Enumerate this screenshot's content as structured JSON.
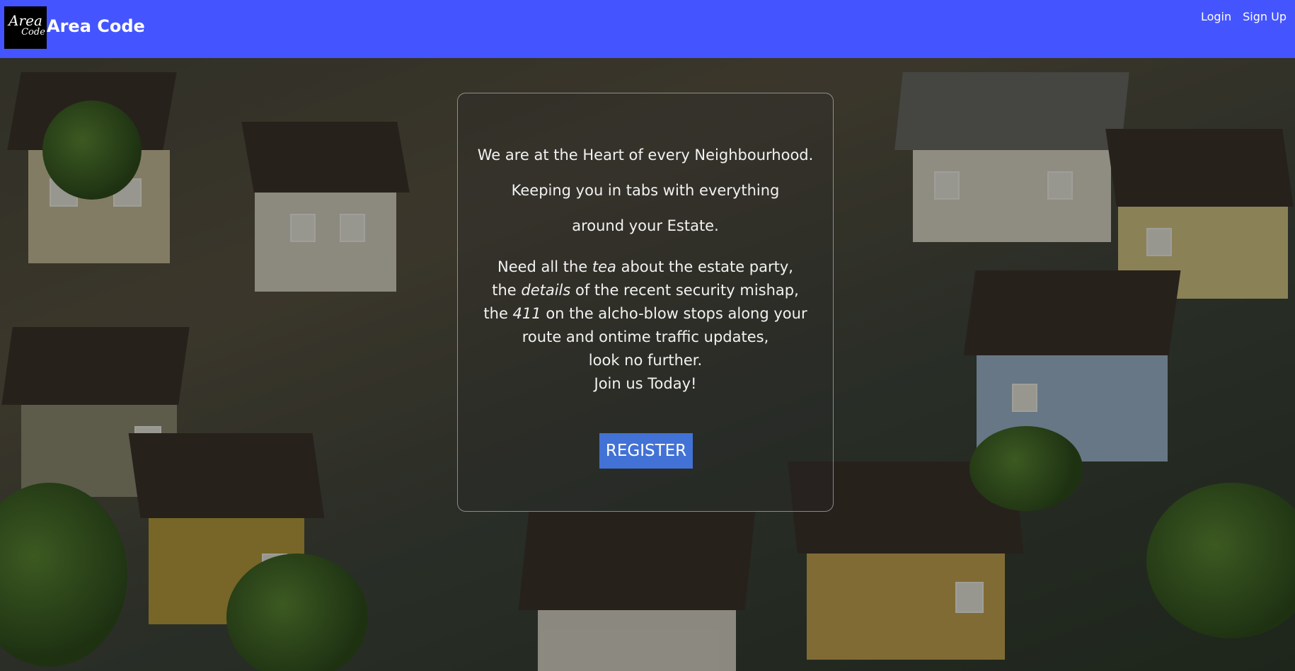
{
  "header": {
    "logo_line1": "Area",
    "logo_line2": "Code",
    "brand": "Area Code",
    "login": "Login",
    "signup": "Sign Up"
  },
  "hero": {
    "line1": "We are at the Heart of every Neighbourhood.",
    "line2": "Keeping you in tabs with everything",
    "line3": "around your Estate.",
    "para": {
      "a1": "Need all the ",
      "a_em": "tea",
      "a2": " about the estate party,",
      "b1": "the ",
      "b_em": "details",
      "b2": " of the recent security mishap,",
      "c1": "the ",
      "c_em": "411",
      "c2": " on the alcho-blow stops along your",
      "d": "route and ontime traffic updates,",
      "e": "look no further.",
      "f": "Join us Today!"
    },
    "register": "REGISTER"
  },
  "colors": {
    "navbar": "#4455ff",
    "button": "#4272d6"
  }
}
